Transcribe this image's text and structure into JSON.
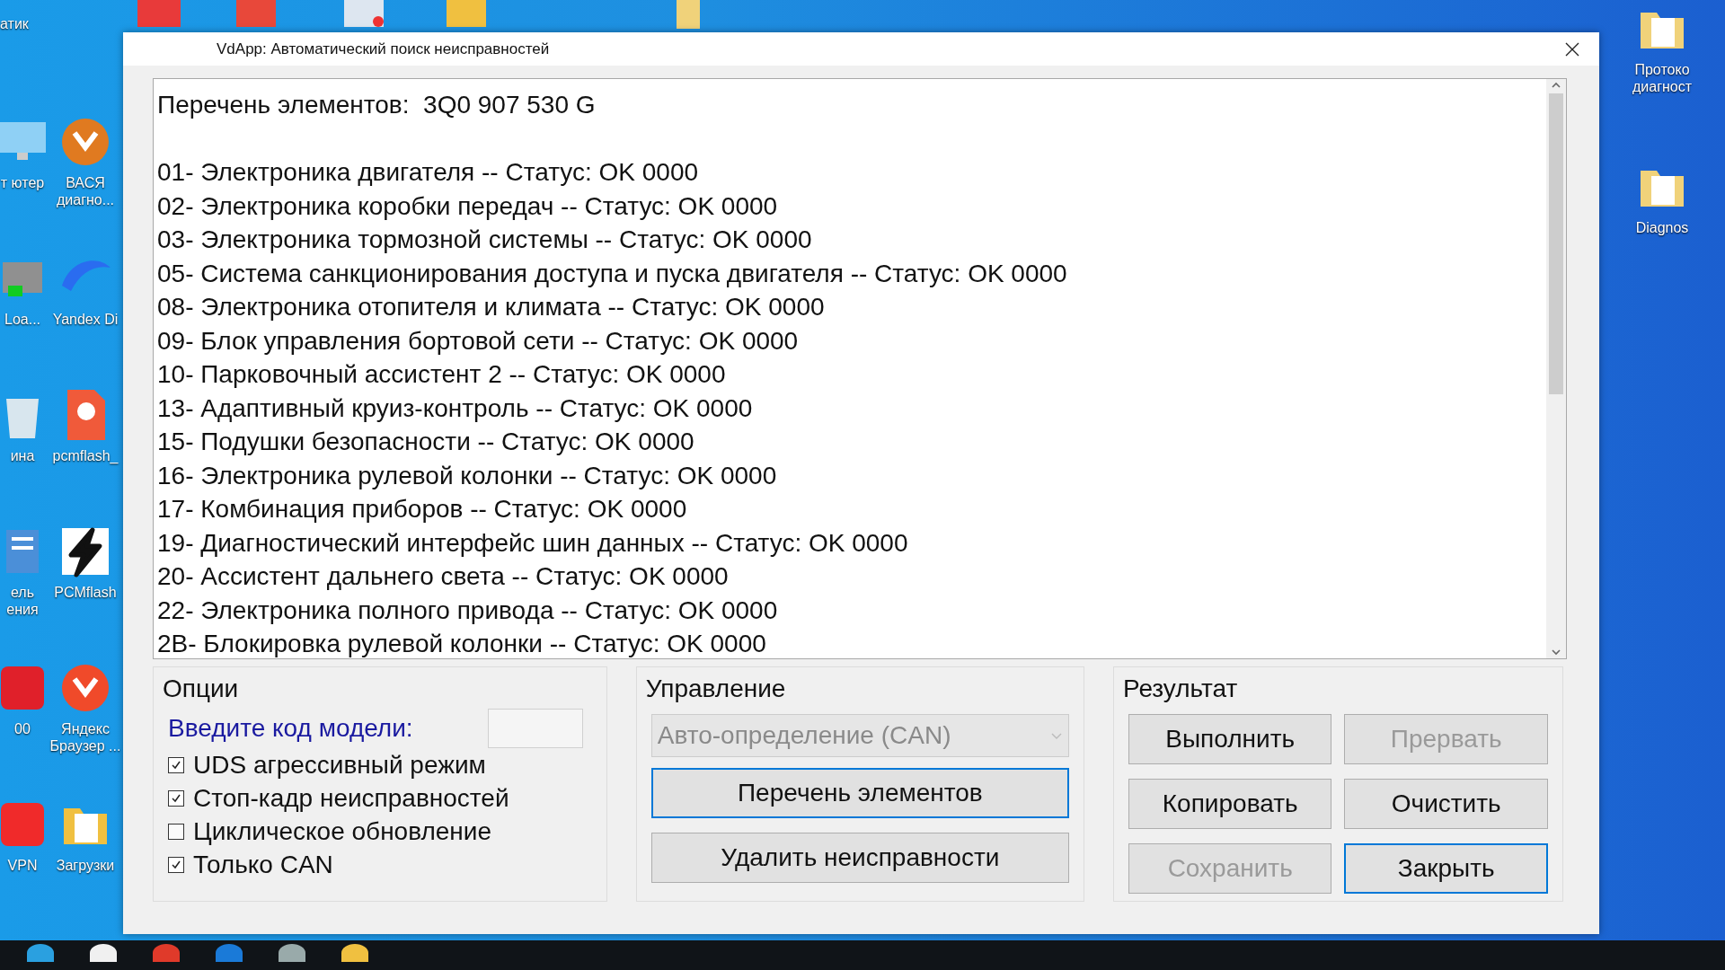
{
  "desktop": {
    "top_labels": [
      "атик"
    ],
    "column_1": [
      {
        "label": "т ютер",
        "kind": "screen",
        "color": "#8fd0f5"
      },
      {
        "label": "Loa...",
        "kind": "chip",
        "color": "#909090"
      },
      {
        "label": "ина",
        "kind": "bin",
        "color": "#d8e6ee"
      },
      {
        "label": "ель ения",
        "kind": "doc",
        "color": "#4b8fd8"
      },
      {
        "label": "00",
        "kind": "tile",
        "color": "#e0202a"
      },
      {
        "label": "VPN",
        "kind": "tile",
        "color": "#f02a2a"
      }
    ],
    "column_2": [
      {
        "label": "ВАСЯ диагно...",
        "kind": "circle",
        "color": "#e07a20"
      },
      {
        "label": "Yandex Di",
        "kind": "disk",
        "color": "#2a6cf0"
      },
      {
        "label": "pcmflash_",
        "kind": "pdf",
        "color": "#f05a3a"
      },
      {
        "label": "PCMflash",
        "kind": "bolt",
        "color": "#111111"
      },
      {
        "label": "Яндекс Браузер ...",
        "kind": "circle",
        "color": "#f04a2a"
      },
      {
        "label": "Загрузки",
        "kind": "folder",
        "color": "#f0c040"
      }
    ],
    "right_column": [
      {
        "label": "Протоко диагност",
        "kind": "folder",
        "color": "#f0d27a"
      },
      {
        "label": "Diagnos",
        "kind": "folder",
        "color": "#f0d27a"
      }
    ]
  },
  "window": {
    "title": "VdApp: Автоматический поиск неисправностей",
    "list": {
      "header": "Перечень элементов:  3Q0 907 530 G",
      "lines": [
        "01- Электроника двигателя -- Статус: OK 0000",
        "02- Электроника коробки передач -- Статус: OK 0000",
        "03- Электроника тормозной системы -- Статус: OK 0000",
        "05- Система санкционирования доступа и пуска двигателя -- Статус: OK 0000",
        "08- Электроника отопителя и климата -- Статус: OK 0000",
        "09- Блок управления бортовой сети -- Статус: OK 0000",
        "10- Парковочный ассистент 2 -- Статус: OK 0000",
        "13- Адаптивный круиз-контроль -- Статус: OK 0000",
        "15- Подушки безопасности -- Статус: OK 0000",
        "16- Электроника рулевой колонки -- Статус: OK 0000",
        "17- Комбинация приборов -- Статус: OK 0000",
        "19- Диагностический интерфейс шин данных -- Статус: OK 0000",
        "20- Ассистент дальнего света -- Статус: OK 0000",
        "22- Электроника полного привода -- Статус: OK 0000",
        "2B- Блокировка рулевой колонки -- Статус: OK 0000"
      ]
    },
    "options": {
      "title": "Опции",
      "model_label": "Введите код модели:",
      "checkboxes": [
        {
          "label": "UDS агрессивный режим",
          "checked": true
        },
        {
          "label": "Стоп-кадр неисправностей",
          "checked": true
        },
        {
          "label": "Циклическое обновление",
          "checked": false
        },
        {
          "label": "Только CAN",
          "checked": true
        }
      ]
    },
    "control": {
      "title": "Управление",
      "select": {
        "value": "Авто-определение (CAN)",
        "disabled": true
      },
      "buttons": [
        {
          "label": "Перечень элементов",
          "focused": true
        },
        {
          "label": "Удалить неисправности",
          "focused": false
        }
      ]
    },
    "result": {
      "title": "Результат",
      "buttons": [
        {
          "label": "Выполнить",
          "disabled": false,
          "focused": false
        },
        {
          "label": "Прервать",
          "disabled": true,
          "focused": false
        },
        {
          "label": "Копировать",
          "disabled": false,
          "focused": false
        },
        {
          "label": "Очистить",
          "disabled": false,
          "focused": false
        },
        {
          "label": "Сохранить",
          "disabled": true,
          "focused": false
        },
        {
          "label": "Закрыть",
          "disabled": false,
          "focused": true
        }
      ]
    }
  }
}
